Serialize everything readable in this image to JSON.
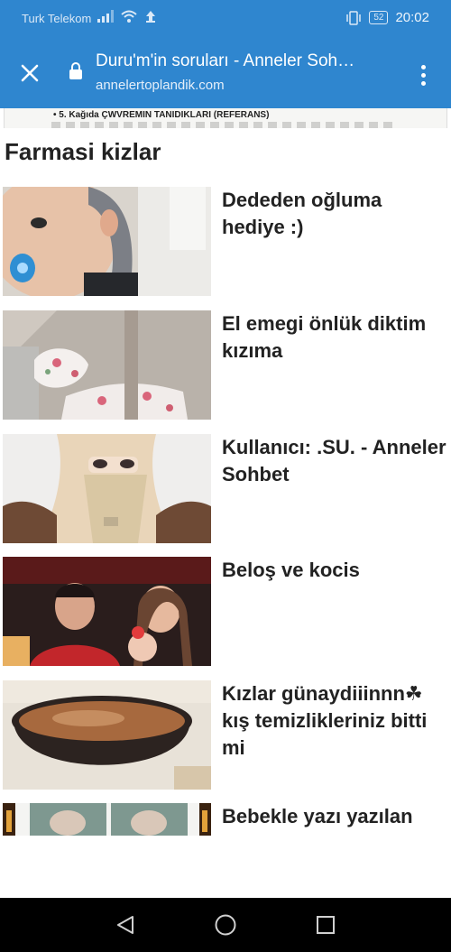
{
  "status_bar": {
    "carrier": "Turk Telekom",
    "battery": "52",
    "time": "20:02"
  },
  "toolbar": {
    "title": "Duru'm'in soruları - Anneler Soh…",
    "url": "annelertoplandik.com"
  },
  "doc_strip": {
    "text": "• 5. Kağıda ÇWVREMIN TANIDIKLARI (REFERANS)"
  },
  "section": {
    "title": "Farmasi kizlar"
  },
  "articles": [
    {
      "title": "Dededen oğluma hediye :)"
    },
    {
      "title": "El emegi önlük diktim kızıma"
    },
    {
      "title": "Kullanıcı: .SU. - Anneler Sohbet"
    },
    {
      "title": "Beloş ve kocis"
    },
    {
      "title": "Kızlar günaydiiinnn☘ kış temizlikleriniz bitti mi"
    },
    {
      "title": "Bebekle yazı yazılan"
    }
  ],
  "icons": {
    "close": "close-icon",
    "lock": "lock-icon",
    "menu": "more-vertical-icon",
    "back": "back-triangle-icon",
    "home": "home-circle-icon",
    "recents": "recents-square-icon"
  },
  "colors": {
    "toolbar": "#2f86cf",
    "navbar": "#000000",
    "text": "#222222"
  }
}
